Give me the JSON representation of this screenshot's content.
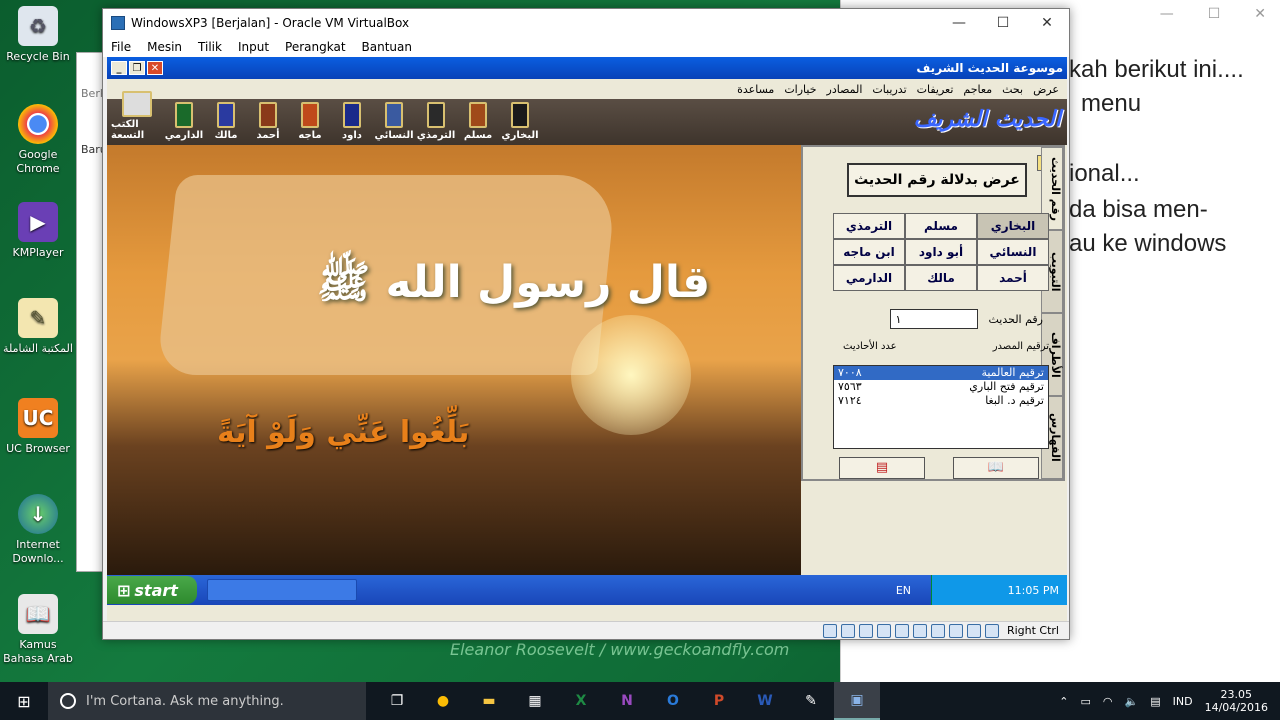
{
  "desktop": {
    "icons": [
      {
        "label": "Recycle Bin",
        "name": "recycle-bin-icon"
      },
      {
        "label": "Google Chrome",
        "name": "chrome-icon"
      },
      {
        "label": "KMPlayer",
        "name": "kmplayer-icon"
      },
      {
        "label": "المكتبة الشاملة",
        "name": "library-icon"
      },
      {
        "label": "UC Browser",
        "name": "uc-browser-icon"
      },
      {
        "label": "Internet Downlo...",
        "name": "idm-icon"
      },
      {
        "label": "Kamus Bahasa Arab",
        "name": "kamus-icon"
      }
    ],
    "partial_labels": {
      "berk": "Berk",
      "baru": "Baru"
    }
  },
  "doc": {
    "lines": [
      "kah berikut ini....",
      "menu",
      "ional...",
      "da bisa men-",
      "au ke windows"
    ]
  },
  "vbox": {
    "title": "WindowsXP3 [Berjalan] - Oracle VM VirtualBox",
    "menu": [
      "File",
      "Mesin",
      "Tilik",
      "Input",
      "Perangkat",
      "Bantuan"
    ],
    "status_right": "Right Ctrl"
  },
  "app": {
    "title": "موسوعة الحديث الشريف",
    "menu": [
      "عرض",
      "بحث",
      "معاجم",
      "تعريفات",
      "تدريبات",
      "المصادر",
      "خيارات",
      "مساعدة"
    ],
    "logo": "الحديث الشريف",
    "toolbar_books": [
      "الكتب التسعة",
      "الدارمي",
      "مالك",
      "أحمد",
      "ماجه",
      "داود",
      "النسائي",
      "الترمذي",
      "مسلم",
      "البخاري"
    ],
    "art": {
      "calligraphy": "قال رسول الله ﷺ",
      "verse": "بَلِّغُوا عَنِّي وَلَوْ آيَةً"
    },
    "panel": {
      "header": "عرض بدلالة رقم الحديث",
      "side_tabs": [
        "رقم الحديث",
        "التبويب",
        "الأطراف",
        "الفهارس"
      ],
      "books": [
        "البخاري",
        "مسلم",
        "الترمذي",
        "النسائي",
        "أبو داود",
        "ابن ماجه",
        "أحمد",
        "مالك",
        "الدارمي"
      ],
      "number_label": "رقم الحديث",
      "number_value": "١",
      "col_source": "ترقيم المصدر",
      "col_count": "عدد الأحاديث",
      "numbering": [
        {
          "name": "ترقيم العالمية",
          "count": "٧٠٠٨"
        },
        {
          "name": "ترقيم فتح الباري",
          "count": "٧٥٦٣"
        },
        {
          "name": "ترقيم د. البغا",
          "count": "٧١٢٤"
        }
      ]
    }
  },
  "xp_taskbar": {
    "start": "start",
    "lang": "EN",
    "time": "11:05 PM"
  },
  "watermark": "Eleanor Roosevelt  /  www.geckoandfly.com",
  "win10": {
    "cortana": "I'm Cortana. Ask me anything.",
    "lang": "IND",
    "time": "23.05",
    "date": "14/04/2016",
    "apps": [
      "task-view",
      "chrome",
      "explorer",
      "store",
      "excel",
      "onenote",
      "outlook",
      "powerpoint",
      "word",
      "kamus",
      "virtualbox"
    ]
  }
}
